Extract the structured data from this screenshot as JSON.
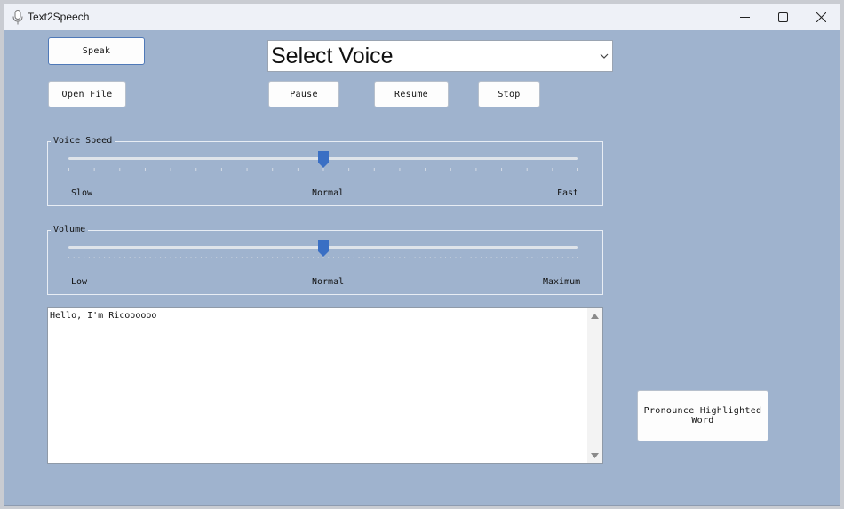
{
  "window": {
    "title": "Text2Speech"
  },
  "window_controls": {
    "minimize": "minimize",
    "maximize": "maximize",
    "close": "close"
  },
  "toolbar": {
    "speak_label": "Speak",
    "open_file_label": "Open File",
    "pause_label": "Pause",
    "resume_label": "Resume",
    "stop_label": "Stop"
  },
  "voice_select": {
    "selected": "Select Voice"
  },
  "voice_speed": {
    "legend": "Voice Speed",
    "labels": {
      "low": "Slow",
      "mid": "Normal",
      "high": "Fast"
    },
    "value_fraction": 0.5
  },
  "volume": {
    "legend": "Volume",
    "labels": {
      "low": "Low",
      "mid": "Normal",
      "high": "Maximum"
    },
    "value_fraction": 0.5
  },
  "editor": {
    "text": "Hello, I'm Ricoooooo"
  },
  "pronounce_button": {
    "label": "Pronounce Highlighted Word"
  },
  "colors": {
    "window_background": "#9fb3ce",
    "slider_thumb": "#3a6fc4",
    "button_focus_border": "#4f79b8"
  },
  "icons": {
    "app": "microphone-icon",
    "select": "chevron-down-icon"
  }
}
